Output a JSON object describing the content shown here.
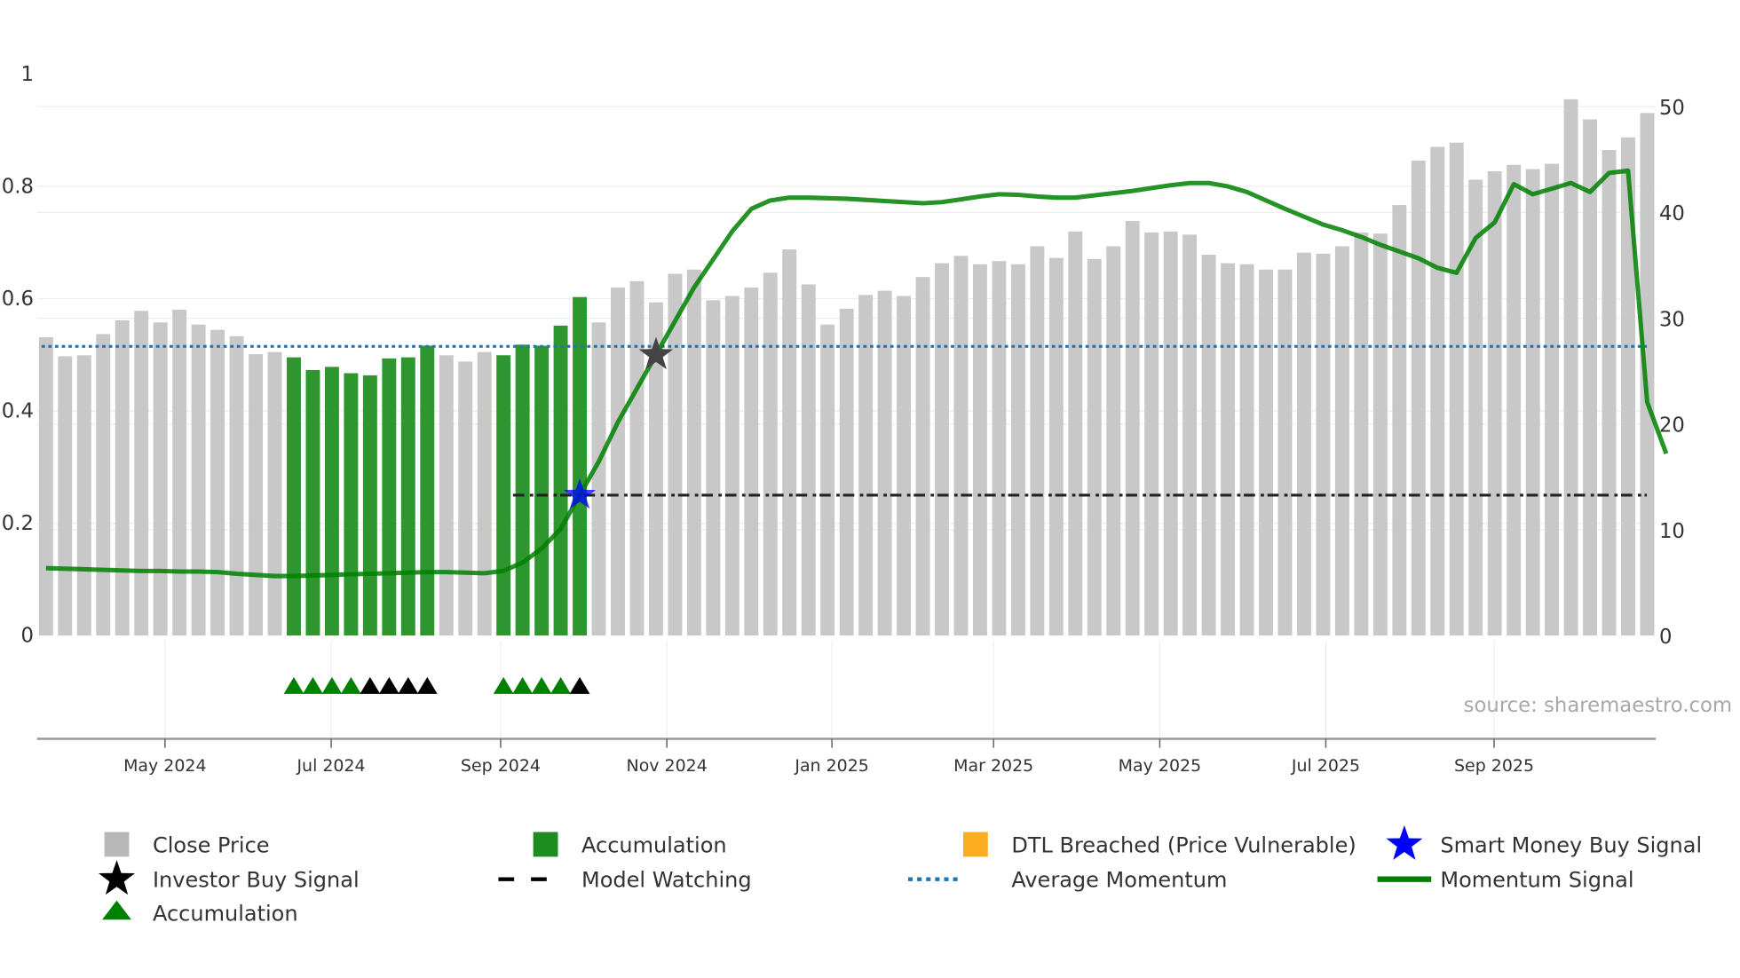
{
  "chart_data": {
    "type": "bar",
    "title": "",
    "source": "source: sharemaestro.com",
    "left_axis": {
      "ticks": [
        0,
        0.2,
        0.4,
        0.6,
        0.8,
        1
      ],
      "tick_labels": [
        "0",
        "0.2",
        "0.4",
        "0.6",
        "0.8",
        "1"
      ],
      "range": [
        0,
        1
      ]
    },
    "right_axis": {
      "ticks": [
        0,
        10,
        20,
        30,
        40,
        50
      ],
      "tick_labels": [
        "0",
        "10",
        "20",
        "30",
        "40",
        "50"
      ],
      "range": [
        0,
        50
      ]
    },
    "x_ticks": [
      {
        "label": "May 2024",
        "week_index": 6.24
      },
      {
        "label": "Jul 2024",
        "week_index": 14.96
      },
      {
        "label": "Sep 2024",
        "week_index": 23.85
      },
      {
        "label": "Nov 2024",
        "week_index": 32.57
      },
      {
        "label": "Jan 2025",
        "week_index": 41.23
      },
      {
        "label": "Mar 2025",
        "week_index": 49.71
      },
      {
        "label": "May 2025",
        "week_index": 58.43
      },
      {
        "label": "Jul 2025",
        "week_index": 67.14
      },
      {
        "label": "Sep 2025",
        "week_index": 75.97
      }
    ],
    "close_price": [
      28.2,
      26.4,
      26.5,
      28.5,
      29.8,
      30.7,
      29.6,
      30.8,
      29.4,
      28.9,
      28.3,
      26.6,
      26.8,
      26.3,
      25.1,
      25.4,
      24.8,
      24.6,
      26.2,
      26.3,
      27.4,
      26.5,
      25.9,
      26.8,
      26.5,
      27.5,
      27.4,
      29.3,
      32.0,
      29.6,
      32.9,
      33.5,
      31.5,
      34.2,
      34.6,
      31.7,
      32.1,
      32.9,
      34.3,
      36.5,
      33.2,
      29.4,
      30.9,
      32.2,
      32.6,
      32.1,
      33.9,
      35.2,
      35.9,
      35.1,
      35.4,
      35.1,
      36.8,
      35.7,
      38.2,
      35.6,
      36.8,
      39.2,
      38.1,
      38.2,
      37.9,
      36.0,
      35.2,
      35.1,
      34.6,
      34.6,
      36.2,
      36.1,
      36.8,
      38.1,
      38.0,
      40.7,
      44.9,
      46.2,
      46.6,
      43.1,
      43.9,
      44.5,
      44.1,
      44.6,
      50.7,
      48.8,
      45.9,
      47.1,
      49.4
    ],
    "accumulation_bar_indices": [
      13,
      14,
      15,
      16,
      17,
      18,
      19,
      20,
      24,
      25,
      26,
      27,
      28
    ],
    "momentum_signal": [
      0.12,
      0.119,
      0.118,
      0.117,
      0.116,
      0.115,
      0.115,
      0.114,
      0.114,
      0.113,
      0.11,
      0.108,
      0.106,
      0.106,
      0.107,
      0.108,
      0.109,
      0.11,
      0.111,
      0.112,
      0.113,
      0.113,
      0.112,
      0.111,
      0.115,
      0.13,
      0.155,
      0.19,
      0.25,
      0.31,
      0.38,
      0.44,
      0.5,
      0.56,
      0.62,
      0.67,
      0.72,
      0.76,
      0.775,
      0.78,
      0.78,
      0.779,
      0.778,
      0.776,
      0.774,
      0.772,
      0.77,
      0.772,
      0.777,
      0.782,
      0.786,
      0.785,
      0.782,
      0.78,
      0.78,
      0.784,
      0.788,
      0.792,
      0.797,
      0.802,
      0.806,
      0.806,
      0.8,
      0.79,
      0.775,
      0.76,
      0.746,
      0.732,
      0.722,
      0.71,
      0.696,
      0.684,
      0.672,
      0.655,
      0.646,
      0.708,
      0.736,
      0.804,
      0.786,
      0.796,
      0.806,
      0.79,
      0.824,
      0.828,
      0.416,
      0.324
    ],
    "average_momentum": 0.515,
    "model_watching": {
      "value": 0.25,
      "start_index": 24.5
    },
    "investor_buy_signal": {
      "index": 32,
      "value": 0.5
    },
    "smart_money_buy_signal": {
      "index": 28,
      "value": 0.25
    },
    "accumulation_markers": [
      {
        "index": 13,
        "color": "green"
      },
      {
        "index": 14,
        "color": "green"
      },
      {
        "index": 15,
        "color": "green"
      },
      {
        "index": 16,
        "color": "green"
      },
      {
        "index": 17,
        "color": "black"
      },
      {
        "index": 18,
        "color": "black"
      },
      {
        "index": 19,
        "color": "black"
      },
      {
        "index": 20,
        "color": "black"
      },
      {
        "index": 24,
        "color": "green"
      },
      {
        "index": 25,
        "color": "green"
      },
      {
        "index": 26,
        "color": "green"
      },
      {
        "index": 27,
        "color": "green"
      },
      {
        "index": 28,
        "color": "black"
      }
    ],
    "colors": {
      "close_price": "#c8c8c8",
      "accumulation": "#2e962e",
      "dtl_breached": "#fbad1f",
      "smart_money": "#0000ff",
      "investor": "#000000",
      "model_watching": "#000000",
      "average_momentum": "#1f77b4",
      "momentum": "#008000",
      "triangle_green": "#008000",
      "triangle_black": "#000000"
    },
    "legend": [
      {
        "label": "Close Price",
        "symbol": "square",
        "color": "#b8b8b8"
      },
      {
        "label": "Accumulation",
        "symbol": "square",
        "color": "#1e8c1e"
      },
      {
        "label": "DTL Breached (Price Vulnerable)",
        "symbol": "square",
        "color": "#fbad1f"
      },
      {
        "label": "Smart Money Buy Signal",
        "symbol": "star",
        "color": "#0000ff"
      },
      {
        "label": "Investor Buy Signal",
        "symbol": "star",
        "color": "#000000"
      },
      {
        "label": "Model Watching",
        "symbol": "dash",
        "color": "#000000"
      },
      {
        "label": "Average Momentum",
        "symbol": "dot",
        "color": "#1f77b4"
      },
      {
        "label": "Momentum Signal",
        "symbol": "line",
        "color": "#008000"
      },
      {
        "label": "Accumulation",
        "symbol": "triangle",
        "color": "#008000"
      }
    ]
  }
}
